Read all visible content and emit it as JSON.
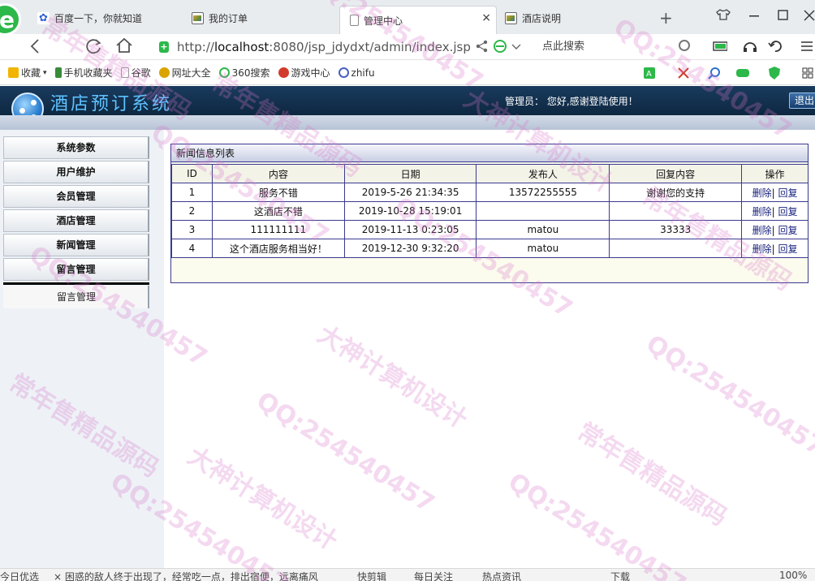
{
  "browser": {
    "tabs": [
      {
        "label": "百度一下，你就知道",
        "icon": "baidu-paw-icon"
      },
      {
        "label": "我的订单",
        "icon": "picture-icon"
      },
      {
        "label": "管理中心",
        "icon": "document-icon",
        "active": true
      },
      {
        "label": "酒店说明",
        "icon": "picture-icon"
      }
    ],
    "close_glyph": "×",
    "new_tab_glyph": "+",
    "url_prefix": "http://",
    "url_host": "localhost",
    "url_rest": ":8080/jsp_jdydxt/admin/index.jsp",
    "search_placeholder": "点此搜索",
    "bookmarks": [
      {
        "label": "收藏",
        "color": "#f2b400"
      },
      {
        "label": "手机收藏夹",
        "color": "#3a8a3a"
      },
      {
        "label": "谷歌",
        "color": "#999999"
      },
      {
        "label": "网址大全",
        "color": "#d9a400"
      },
      {
        "label": "360搜索",
        "color": "#2db84a"
      },
      {
        "label": "游戏中心",
        "color": "#d23b2b"
      },
      {
        "label": "zhifu",
        "color": "#4a5fc2"
      }
    ]
  },
  "app": {
    "title": "酒店预订系统",
    "admin_label": "管理员：",
    "greeting": "您好,感谢登陆使用！",
    "logout": "退出"
  },
  "sidebar": {
    "items": [
      {
        "label": "系统参数"
      },
      {
        "label": "用户维护"
      },
      {
        "label": "会员管理"
      },
      {
        "label": "酒店管理"
      },
      {
        "label": "新闻管理"
      },
      {
        "label": "留言管理"
      }
    ],
    "sub_item": "留言管理"
  },
  "panel": {
    "title": "新闻信息列表",
    "columns": [
      "ID",
      "内容",
      "日期",
      "发布人",
      "回复内容",
      "操作"
    ],
    "delete_label": "删除",
    "reply_label": "回复",
    "separator": "|",
    "rows": [
      {
        "id": "1",
        "content": "服务不错",
        "date": "2019-5-26 21:34:35",
        "publisher": "13572255555",
        "reply": "谢谢您的支持"
      },
      {
        "id": "2",
        "content": "这酒店不错",
        "date": "2019-10-28 15:19:01",
        "publisher": "",
        "reply": ""
      },
      {
        "id": "3",
        "content": "111111111",
        "date": "2019-11-13 0:23:05",
        "publisher": "matou",
        "reply": "33333"
      },
      {
        "id": "4",
        "content": "这个酒店服务相当好！",
        "date": "2019-12-30 9:32:20",
        "publisher": "matou",
        "reply": ""
      }
    ]
  },
  "statusbar": {
    "items": [
      "今日优选",
      "× 困惑的敌人终于出现了，经常吃一点，排出宿便，远离痛风",
      "快剪辑",
      "每日关注",
      "热点资讯",
      "下载",
      "100%"
    ]
  },
  "watermarks": [
    "QQ:254540457",
    "大神计算机设计",
    "常年售精品源码"
  ]
}
